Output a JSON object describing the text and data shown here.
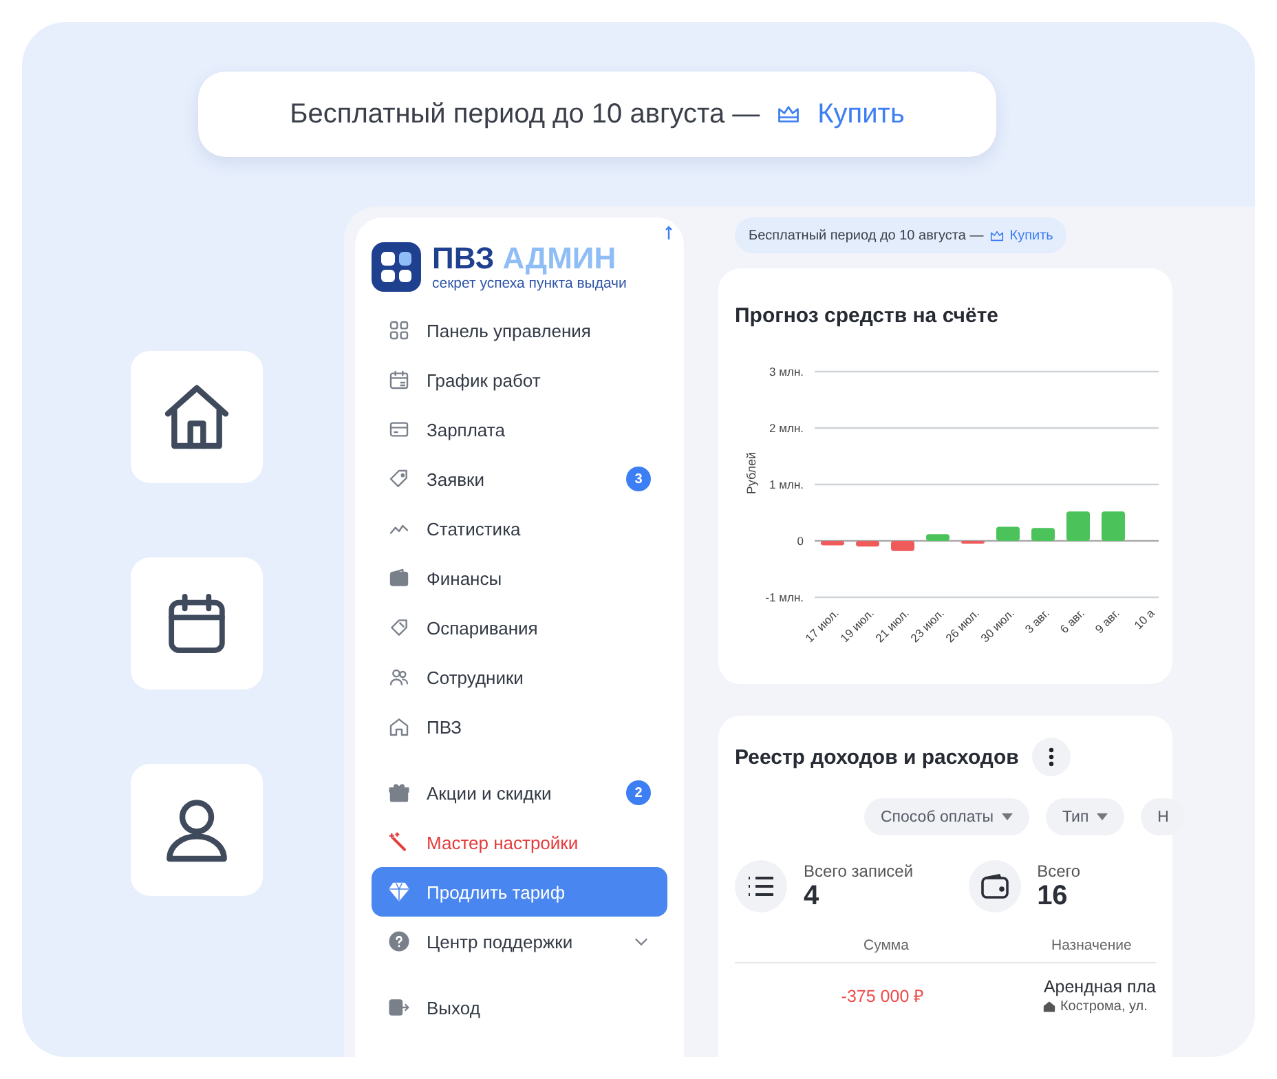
{
  "promo_banner": {
    "text": "Бесплатный период до 10 августа —",
    "link": "Купить"
  },
  "app": {
    "logo": {
      "name_part1": "ПВЗ",
      "name_part2": "АДМИН",
      "tagline": "секрет успеха пункта выдачи"
    },
    "sidebar": {
      "groups": [
        [
          {
            "label": "Панель управления",
            "kind": "link",
            "selected": false
          },
          {
            "label": "График работ",
            "kind": "link",
            "selected": false
          },
          {
            "label": "Зарплата",
            "kind": "link",
            "selected": false
          },
          {
            "label": "Заявки",
            "kind": "link",
            "selected": false,
            "badge": "3"
          },
          {
            "label": "Статистика",
            "kind": "link",
            "selected": false
          },
          {
            "label": "Финансы",
            "kind": "link",
            "selected": false
          },
          {
            "label": "Оспаривания",
            "kind": "link",
            "selected": false
          },
          {
            "label": "Сотрудники",
            "kind": "link",
            "selected": false
          },
          {
            "label": "ПВЗ",
            "kind": "link",
            "selected": false
          }
        ],
        [
          {
            "label": "Акции и скидки",
            "kind": "link",
            "selected": false,
            "badge": "2"
          },
          {
            "label": "Мастер настройки",
            "kind": "accent",
            "selected": false
          },
          {
            "label": "Продлить тариф",
            "kind": "link",
            "selected": true
          },
          {
            "label": "Центр поддержки",
            "kind": "expandable",
            "selected": false,
            "expanded": false
          }
        ],
        [
          {
            "label": "Выход",
            "kind": "link",
            "selected": false
          }
        ]
      ]
    },
    "trial_banner": {
      "text": "Бесплатный период до 10 августа —",
      "link": "Купить"
    },
    "forecast": {
      "title": "Прогноз средств на счёте",
      "chart_data": {
        "type": "bar",
        "ylabel": "Рублей",
        "categories": [
          "17 июл.",
          "19 июл.",
          "21 июл.",
          "23 июл.",
          "26 июл.",
          "30 июл.",
          "3 авг.",
          "6 авг.",
          "9 авг.",
          "10 а"
        ],
        "series": [
          {
            "values": [
              -0.08,
              -0.1,
              -0.18,
              0.12,
              -0.05,
              0.25,
              0.23,
              0.52,
              0.52,
              null
            ]
          }
        ],
        "ylim": [
          -1,
          3
        ],
        "yticks": [
          {
            "value": 3,
            "label": "3 млн."
          },
          {
            "value": 2,
            "label": "2 млн."
          },
          {
            "value": 1,
            "label": "1 млн."
          },
          {
            "value": 0,
            "label": "0"
          },
          {
            "value": -1,
            "label": "-1 млн."
          }
        ]
      }
    },
    "registry": {
      "title": "Реестр доходов и расходов",
      "filters": [
        "Способ оплаты",
        "Тип",
        "Н"
      ],
      "stats": [
        {
          "label": "Всего записей",
          "value": "4"
        },
        {
          "label": "Всего",
          "value": "16"
        }
      ],
      "table": {
        "columns": [
          "Сумма",
          "Назначение"
        ],
        "rows": [
          {
            "kind": "expense",
            "amount": "-375 000 ₽",
            "purpose": "Арендная пла",
            "address": "Кострома, ул."
          }
        ]
      }
    }
  }
}
